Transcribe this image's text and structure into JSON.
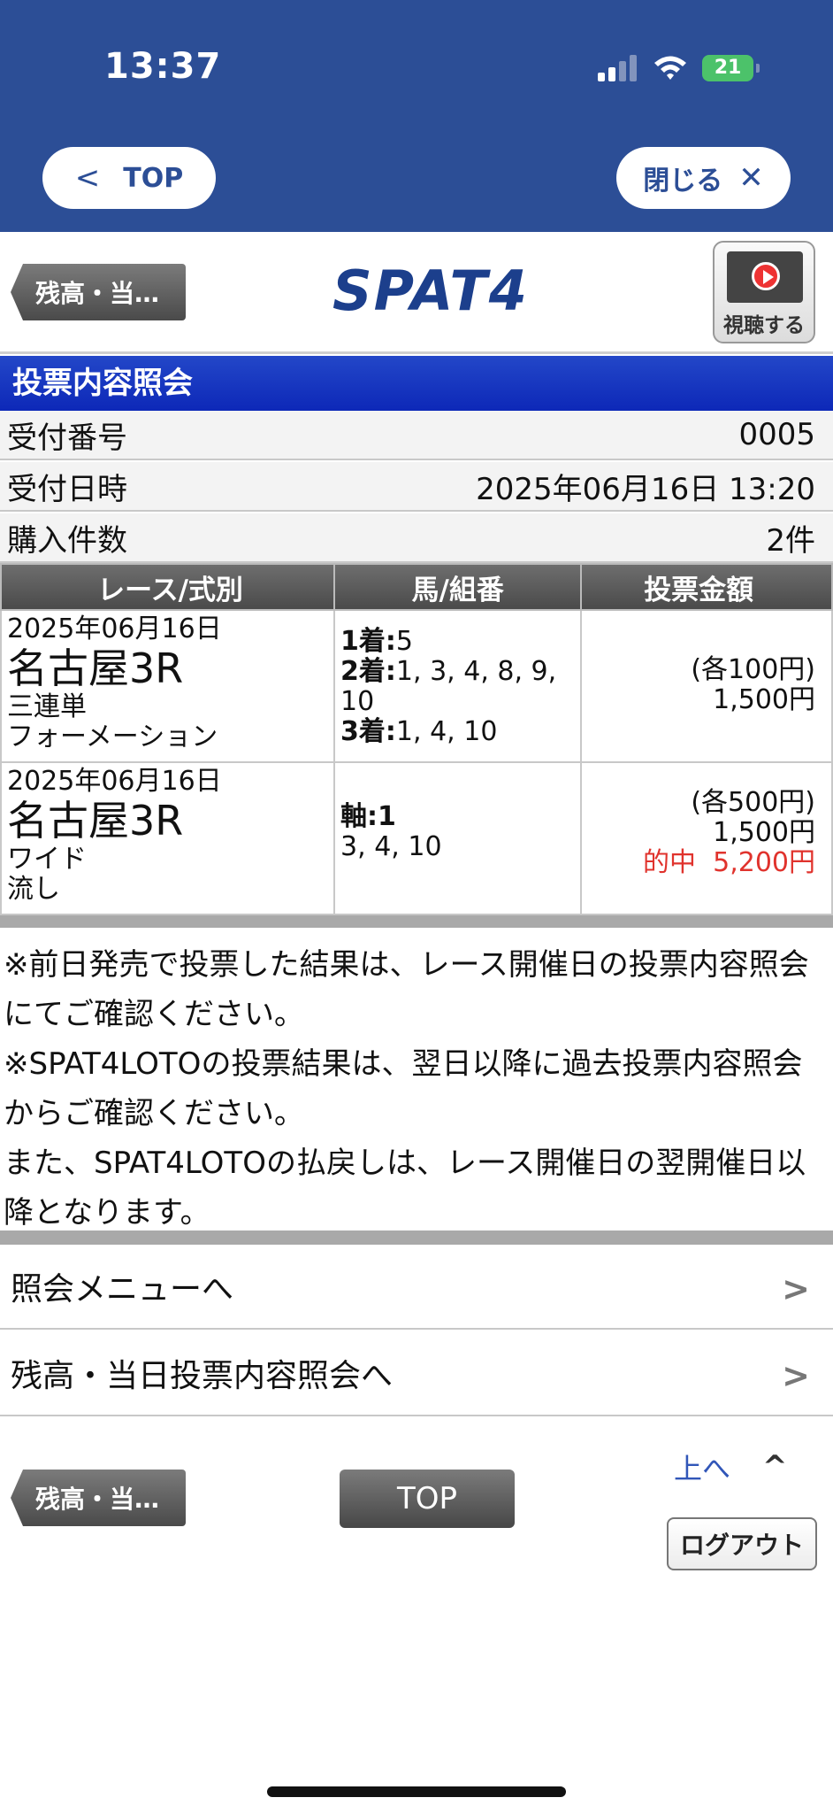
{
  "status_bar": {
    "time": "13:37",
    "battery": "21"
  },
  "nav": {
    "top_label": "TOP",
    "close_label": "閉じる"
  },
  "header": {
    "back_label": "残高・当…",
    "logo": "SPAT4",
    "watch_label": "視聴する"
  },
  "page_title": "投票内容照会",
  "info": {
    "receipt_label": "受付番号",
    "receipt_value": "0005",
    "datetime_label": "受付日時",
    "datetime_value": "2025年06月16日 13:20",
    "count_label": "購入件数",
    "count_value": "2件"
  },
  "table": {
    "headers": [
      "レース/式別",
      "馬/組番",
      "投票金額"
    ],
    "rows": [
      {
        "date": "2025年06月16日",
        "venue": "名古屋3R",
        "bet_type": "三連単",
        "method": "フォーメーション",
        "line1_head": "1着:",
        "line1": "5",
        "line2_head": "2着:",
        "line2": "1, 3, 4, 8, 9, 10",
        "line3_head": "3着:",
        "line3": "1, 4, 10",
        "unit": "(各100円)",
        "amount": "1,500円"
      },
      {
        "date": "2025年06月16日",
        "venue": "名古屋3R",
        "bet_type": "ワイド",
        "method": "流し",
        "axis_head": "軸:1",
        "axis_others": "3, 4, 10",
        "unit": "(各500円)",
        "amount": "1,500円",
        "hit_label": "的中",
        "hit_amount": "5,200円"
      }
    ]
  },
  "notes": {
    "note1": "※前日発売で投票した結果は、レース開催日の投票内容照会にてご確認ください。",
    "note2": "※SPAT4LOTOの投票結果は、翌日以降に過去投票内容照会からご確認ください。",
    "note3": "また、SPAT4LOTOの払戻しは、レース開催日の翌開催日以降となります。"
  },
  "menu": {
    "item1": "照会メニューへ",
    "item2": "残高・当日投票内容照会へ"
  },
  "footer": {
    "back_label": "残高・当…",
    "top_label": "TOP",
    "up_label": "上へ",
    "logout_label": "ログアウト"
  }
}
